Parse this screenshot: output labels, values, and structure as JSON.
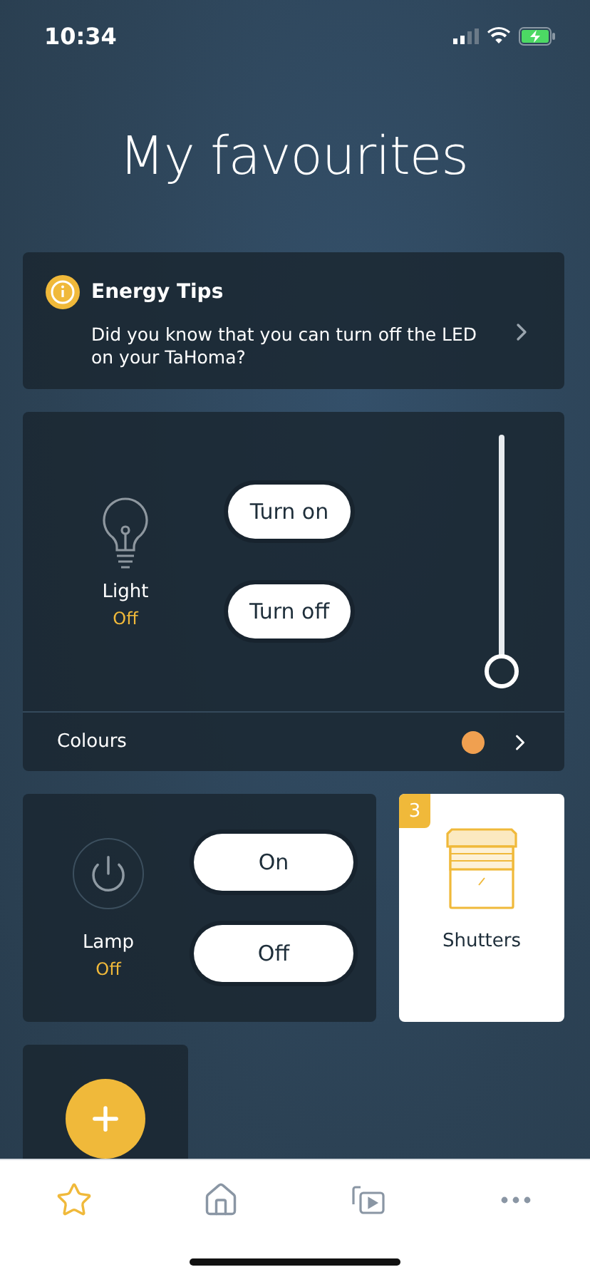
{
  "status_bar": {
    "time": "10:34"
  },
  "title": "My favourites",
  "tip": {
    "title": "Energy Tips",
    "text": "Did you know that you can turn off the LED on your TaHoma?"
  },
  "light": {
    "name": "Light",
    "state": "Off",
    "buttons": [
      "Turn on",
      "Turn off"
    ],
    "level": 0,
    "colours": {
      "label": "Colours",
      "color": "#f0a050"
    }
  },
  "lamp": {
    "name": "Lamp",
    "state": "Off",
    "buttons": [
      "On",
      "Off"
    ]
  },
  "shutters": {
    "name": "Shutters",
    "count": "3"
  },
  "nav": [
    {
      "kind": "favourites",
      "selected": true
    },
    {
      "kind": "home",
      "selected": false
    },
    {
      "kind": "media",
      "selected": false
    },
    {
      "kind": "more",
      "selected": false
    }
  ]
}
